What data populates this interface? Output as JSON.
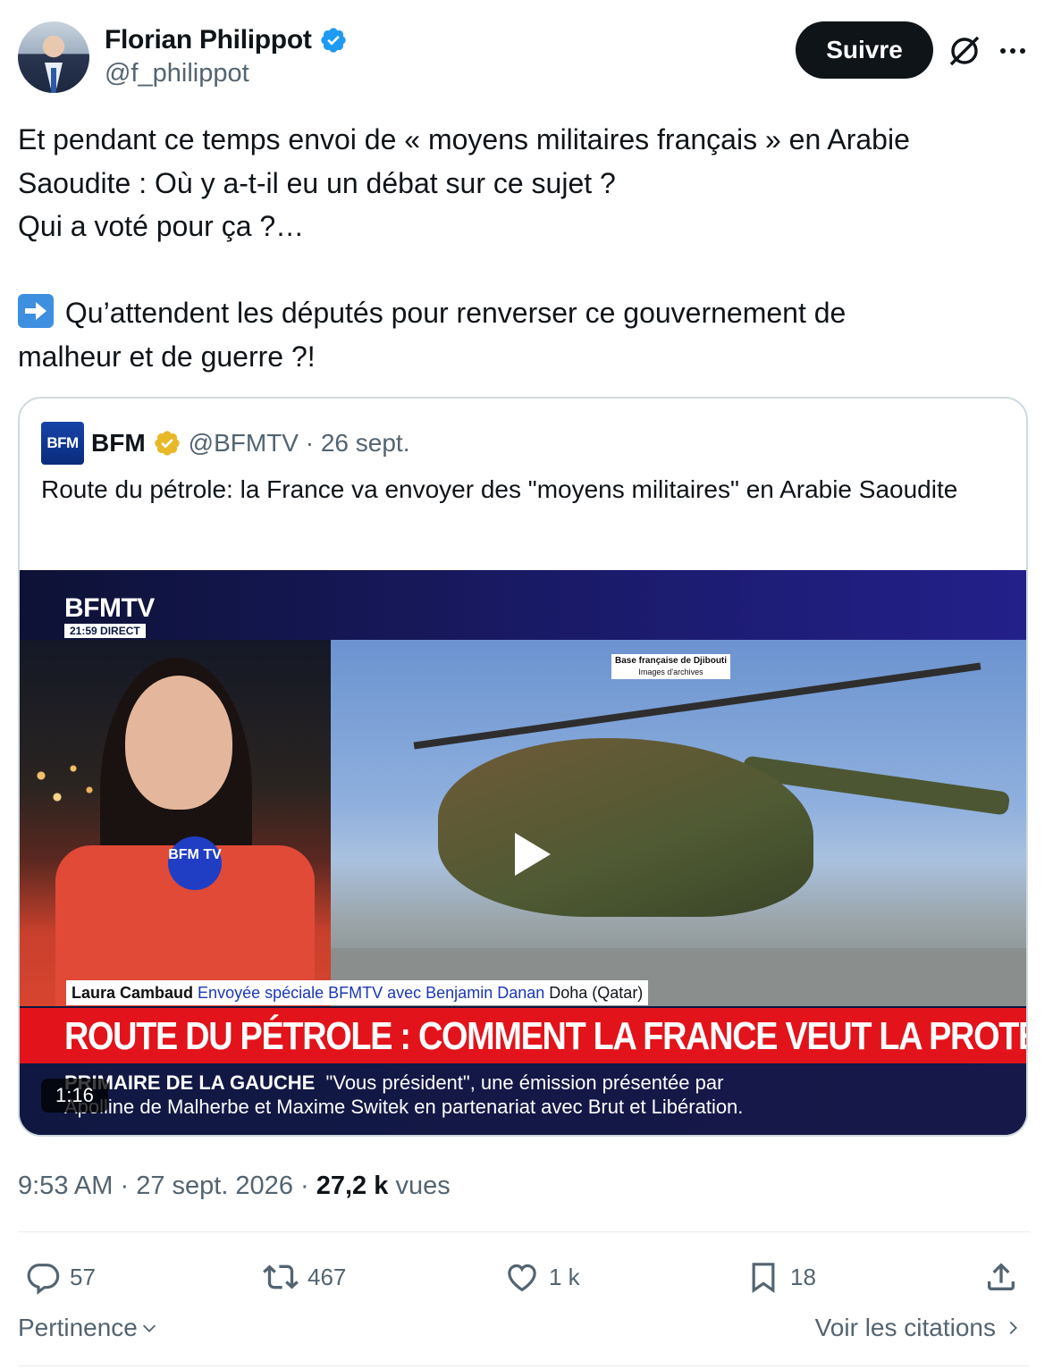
{
  "author": {
    "name": "Florian Philippot",
    "handle": "@f_philippot"
  },
  "header": {
    "follow_label": "Suivre"
  },
  "tweet": {
    "line1": "Et pendant ce temps envoi de « moyens militaires français » en Arabie",
    "line2": "Saoudite : Où y a-t-il eu un débat sur ce sujet ?",
    "line3": "Qui a voté pour ça ?…",
    "line4": " Qu’attendent les députés pour renverser ce gouvernement de",
    "line5": "malheur et de guerre ?!"
  },
  "quote": {
    "logo_text": "BFM",
    "name": "BFM",
    "handle_date": "@BFMTV · 26 sept.",
    "text": "Route du pétrole: la France va envoyer des \"moyens militaires\" en Arabie Saoudite",
    "video": {
      "channel": "BFMTV",
      "clock": "21:59  DIRECT",
      "caption_title": "Base française de Djibouti",
      "caption_sub": "Images d'archives",
      "mic_label": "BFM TV",
      "reporter_name": "Laura Cambaud",
      "reporter_role": "Envoyée spéciale BFMTV avec Benjamin Danan",
      "reporter_location": "Doha (Qatar)",
      "headline": "ROUTE DU PÉTROLE : COMMENT LA FRANCE VEUT LA PROTÉGER",
      "ticker_label": "PRIMAIRE DE LA GAUCHE",
      "ticker_line1": "\"Vous président\", une émission présentée par",
      "ticker_line2": "Apolline de Malherbe et Maxime Switek en partenariat avec Brut et Libération.",
      "duration": "1:16"
    }
  },
  "meta": {
    "time": "9:53 AM",
    "date": "27 sept. 2026",
    "views_count": "27,2 k",
    "views_label": "vues"
  },
  "actions": {
    "replies": "57",
    "reposts": "467",
    "likes": "1 k",
    "bookmarks": "18"
  },
  "footer": {
    "sort_label": "Pertinence",
    "quotes_label": "Voir les citations"
  },
  "colors": {
    "verified_blue": "#1d9bf0",
    "gold_badge": "#e8b829",
    "bfm_red": "#e3131b",
    "text_secondary": "#536471"
  }
}
